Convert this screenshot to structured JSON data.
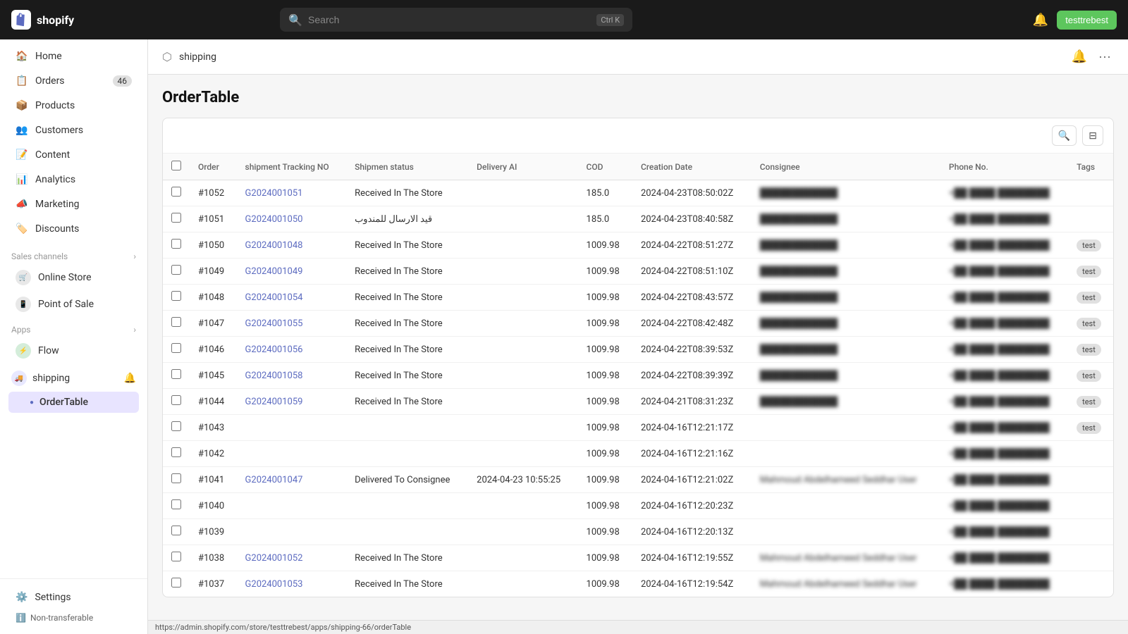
{
  "topnav": {
    "brand": "shopify",
    "search_placeholder": "Search",
    "search_shortcut": "Ctrl K",
    "user_label": "testtrebest",
    "notif_icon": "🔔"
  },
  "sidebar": {
    "nav_items": [
      {
        "id": "home",
        "label": "Home",
        "icon": "home"
      },
      {
        "id": "orders",
        "label": "Orders",
        "badge": "46",
        "icon": "orders"
      },
      {
        "id": "products",
        "label": "Products",
        "icon": "products"
      },
      {
        "id": "customers",
        "label": "Customers",
        "icon": "customers"
      },
      {
        "id": "content",
        "label": "Content",
        "icon": "content"
      },
      {
        "id": "analytics",
        "label": "Analytics",
        "icon": "analytics"
      },
      {
        "id": "marketing",
        "label": "Marketing",
        "icon": "marketing"
      },
      {
        "id": "discounts",
        "label": "Discounts",
        "icon": "discounts"
      }
    ],
    "sales_channels_label": "Sales channels",
    "sales_channels": [
      {
        "id": "online-store",
        "label": "Online Store"
      },
      {
        "id": "point-of-sale",
        "label": "Point of Sale"
      }
    ],
    "apps_label": "Apps",
    "apps": [
      {
        "id": "flow",
        "label": "Flow"
      }
    ],
    "shipping_app": "shipping",
    "ordertable_label": "OrderTable",
    "settings_label": "Settings",
    "non_transferable_label": "Non-transferable"
  },
  "content_header": {
    "breadcrumb": "shipping",
    "title": "OrderTable",
    "bell_icon": "🔔",
    "more_icon": "···"
  },
  "table": {
    "columns": [
      "",
      "Order",
      "shipment Tracking NO",
      "Shipmen status",
      "Delivery AI",
      "COD",
      "Creation Date",
      "Consignee",
      "Phone No.",
      "Tags"
    ],
    "rows": [
      {
        "order": "#1052",
        "tracking": "G2024001051",
        "status": "Received In The Store",
        "delivery_ai": "",
        "cod": "185.0",
        "created": "2024-04-23T08:50:02Z",
        "consignee": "REDACTED",
        "phone": "REDACTED",
        "tags": ""
      },
      {
        "order": "#1051",
        "tracking": "G2024001050",
        "status": "قيد الارسال للمندوب",
        "delivery_ai": "",
        "cod": "185.0",
        "created": "2024-04-23T08:40:58Z",
        "consignee": "REDACTED",
        "phone": "REDACTED",
        "tags": ""
      },
      {
        "order": "#1050",
        "tracking": "G2024001048",
        "status": "Received In The Store",
        "delivery_ai": "",
        "cod": "1009.98",
        "created": "2024-04-22T08:51:27Z",
        "consignee": "REDACTED",
        "phone": "REDACTED",
        "tags": "test"
      },
      {
        "order": "#1049",
        "tracking": "G2024001049",
        "status": "Received In The Store",
        "delivery_ai": "",
        "cod": "1009.98",
        "created": "2024-04-22T08:51:10Z",
        "consignee": "REDACTED",
        "phone": "REDACTED",
        "tags": "test"
      },
      {
        "order": "#1048",
        "tracking": "G2024001054",
        "status": "Received In The Store",
        "delivery_ai": "",
        "cod": "1009.98",
        "created": "2024-04-22T08:43:57Z",
        "consignee": "REDACTED",
        "phone": "REDACTED",
        "tags": "test"
      },
      {
        "order": "#1047",
        "tracking": "G2024001055",
        "status": "Received In The Store",
        "delivery_ai": "",
        "cod": "1009.98",
        "created": "2024-04-22T08:42:48Z",
        "consignee": "REDACTED",
        "phone": "REDACTED",
        "tags": "test"
      },
      {
        "order": "#1046",
        "tracking": "G2024001056",
        "status": "Received In The Store",
        "delivery_ai": "",
        "cod": "1009.98",
        "created": "2024-04-22T08:39:53Z",
        "consignee": "REDACTED",
        "phone": "REDACTED",
        "tags": "test"
      },
      {
        "order": "#1045",
        "tracking": "G2024001058",
        "status": "Received In The Store",
        "delivery_ai": "",
        "cod": "1009.98",
        "created": "2024-04-22T08:39:39Z",
        "consignee": "REDACTED",
        "phone": "REDACTED",
        "tags": "test"
      },
      {
        "order": "#1044",
        "tracking": "G2024001059",
        "status": "Received In The Store",
        "delivery_ai": "",
        "cod": "1009.98",
        "created": "2024-04-21T08:31:23Z",
        "consignee": "REDACTED",
        "phone": "REDACTED",
        "tags": "test"
      },
      {
        "order": "#1043",
        "tracking": "",
        "status": "",
        "delivery_ai": "",
        "cod": "1009.98",
        "created": "2024-04-16T12:21:17Z",
        "consignee": "",
        "phone": "REDACTED",
        "tags": "test"
      },
      {
        "order": "#1042",
        "tracking": "",
        "status": "",
        "delivery_ai": "",
        "cod": "1009.98",
        "created": "2024-04-16T12:21:16Z",
        "consignee": "",
        "phone": "REDACTED",
        "tags": ""
      },
      {
        "order": "#1041",
        "tracking": "G2024001047",
        "status": "Delivered To Consignee",
        "delivery_ai": "2024-04-23 10:55:25",
        "cod": "1009.98",
        "created": "2024-04-16T12:21:02Z",
        "consignee": "REDACTED_LONG",
        "phone": "REDACTED",
        "tags": ""
      },
      {
        "order": "#1040",
        "tracking": "",
        "status": "",
        "delivery_ai": "",
        "cod": "1009.98",
        "created": "2024-04-16T12:20:23Z",
        "consignee": "",
        "phone": "REDACTED",
        "tags": ""
      },
      {
        "order": "#1039",
        "tracking": "",
        "status": "",
        "delivery_ai": "",
        "cod": "1009.98",
        "created": "2024-04-16T12:20:13Z",
        "consignee": "",
        "phone": "REDACTED",
        "tags": ""
      },
      {
        "order": "#1038",
        "tracking": "G2024001052",
        "status": "Received In The Store",
        "delivery_ai": "",
        "cod": "1009.98",
        "created": "2024-04-16T12:19:55Z",
        "consignee": "REDACTED_LONG",
        "phone": "REDACTED",
        "tags": ""
      },
      {
        "order": "#1037",
        "tracking": "G2024001053",
        "status": "Received In The Store",
        "delivery_ai": "",
        "cod": "1009.98",
        "created": "2024-04-16T12:19:54Z",
        "consignee": "REDACTED_LONG",
        "phone": "REDACTED",
        "tags": ""
      }
    ]
  },
  "url_bar": "https://admin.shopify.com/store/testtrebest/apps/shipping-66/orderTable"
}
